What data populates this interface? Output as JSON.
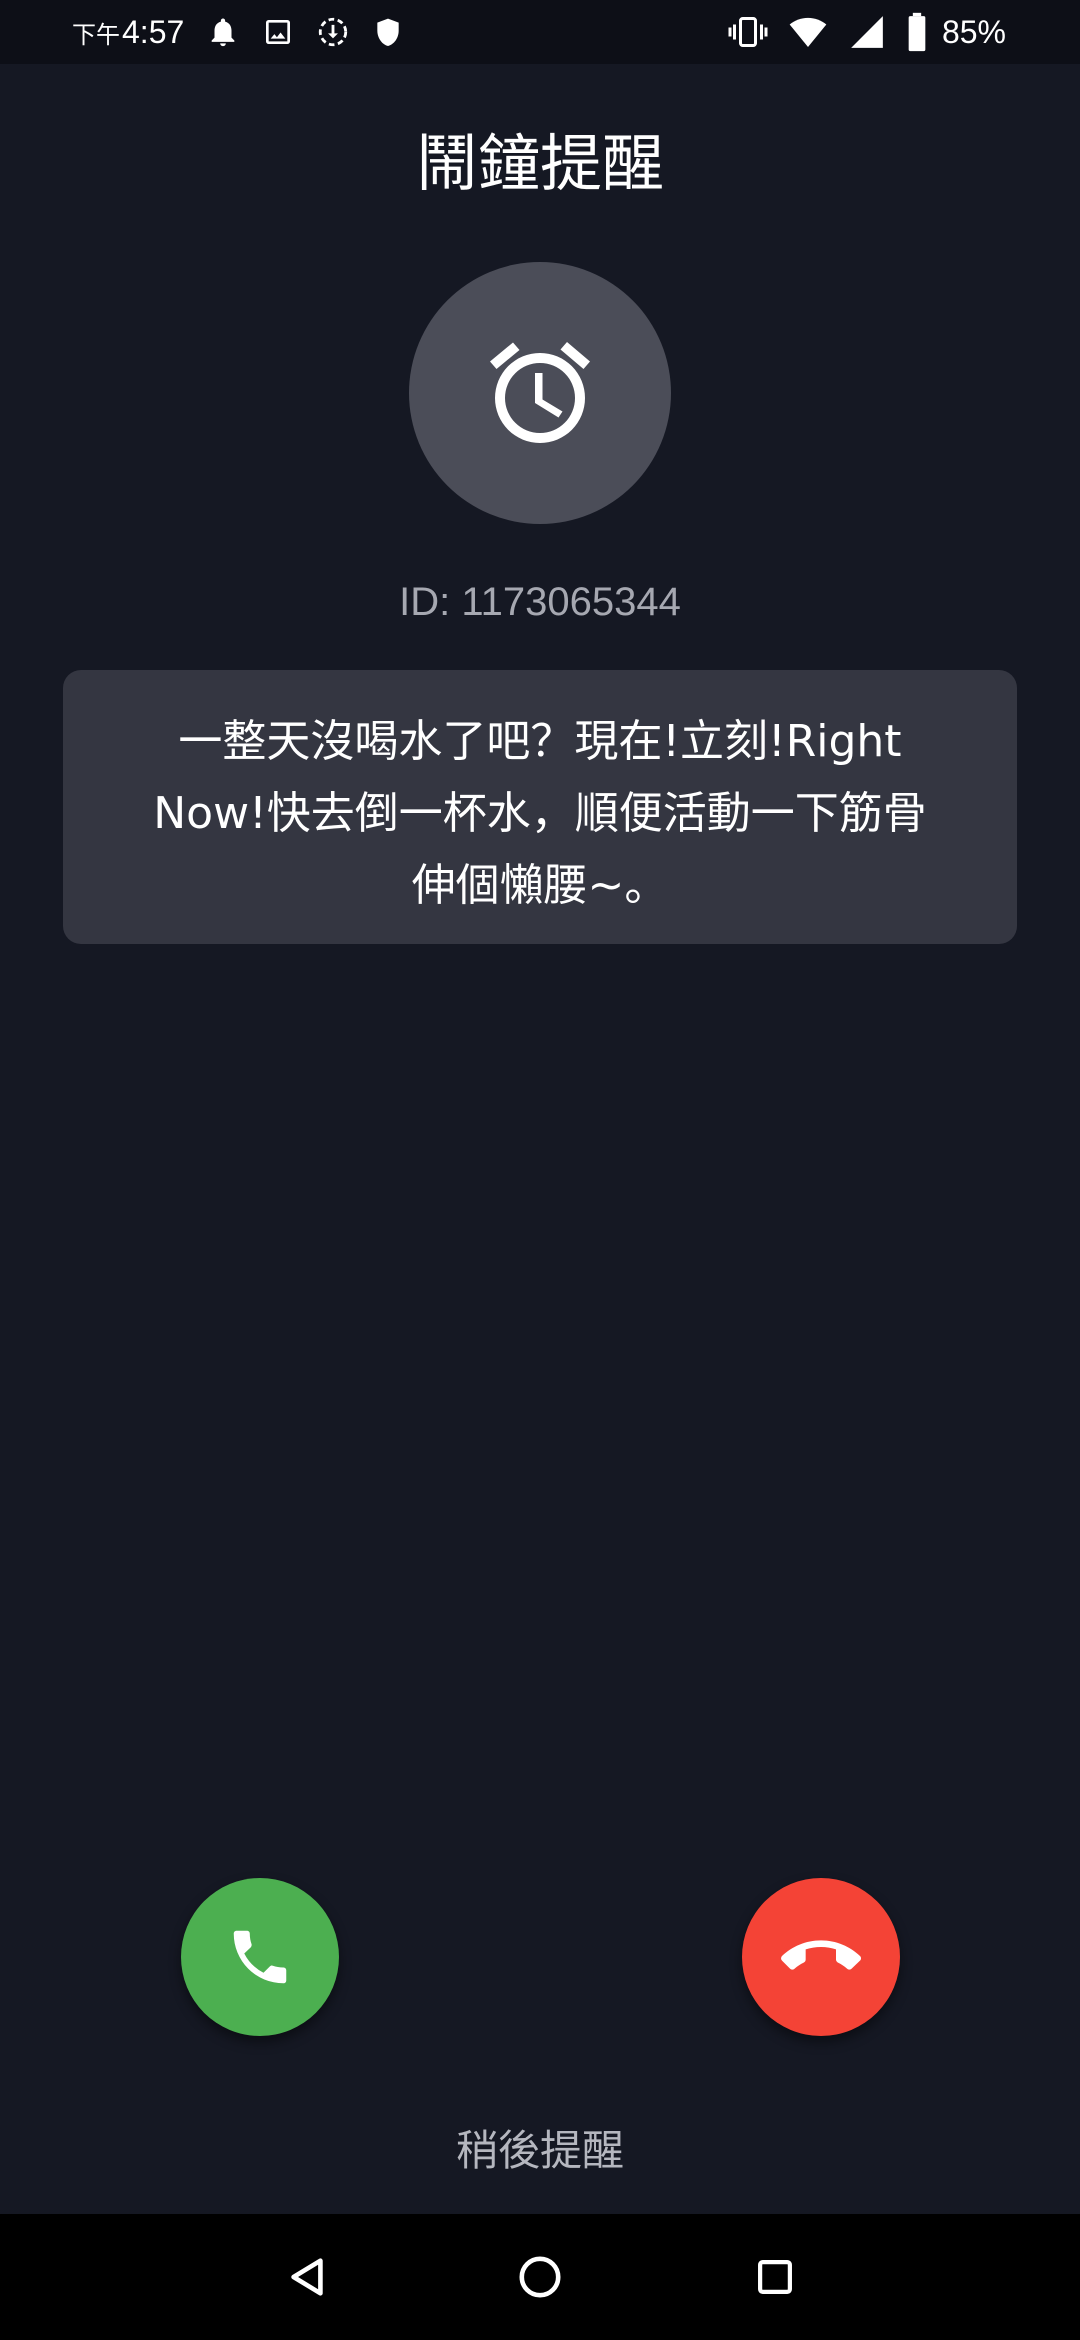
{
  "status_bar": {
    "ampm": "下午",
    "time": "4:57",
    "battery_percent": "85%",
    "left_icons": [
      "alarm-bell-icon",
      "image-icon",
      "download-icon",
      "shield-icon"
    ],
    "right_icons": [
      "vibrate-icon",
      "wifi-icon",
      "cell-signal-icon",
      "battery-icon"
    ]
  },
  "screen": {
    "title": "鬧鐘提醒",
    "avatar_icon": "alarm-clock-icon",
    "id_text": "ID: 1173065344",
    "message": "一整天沒喝水了吧？現在!立刻!Right Now!快去倒一杯水，順便活動一下筋骨伸個懶腰~。"
  },
  "actions": {
    "answer_icon": "phone-icon",
    "decline_icon": "hang-up-icon",
    "snooze_label": "稍後提醒"
  },
  "colors": {
    "background": "#151823",
    "card": "#343641",
    "avatar": "#4b4d58",
    "answer": "#4caf50",
    "decline": "#f44336"
  },
  "nav_bar": {
    "icons": [
      "back-icon",
      "home-icon",
      "recents-icon"
    ]
  }
}
